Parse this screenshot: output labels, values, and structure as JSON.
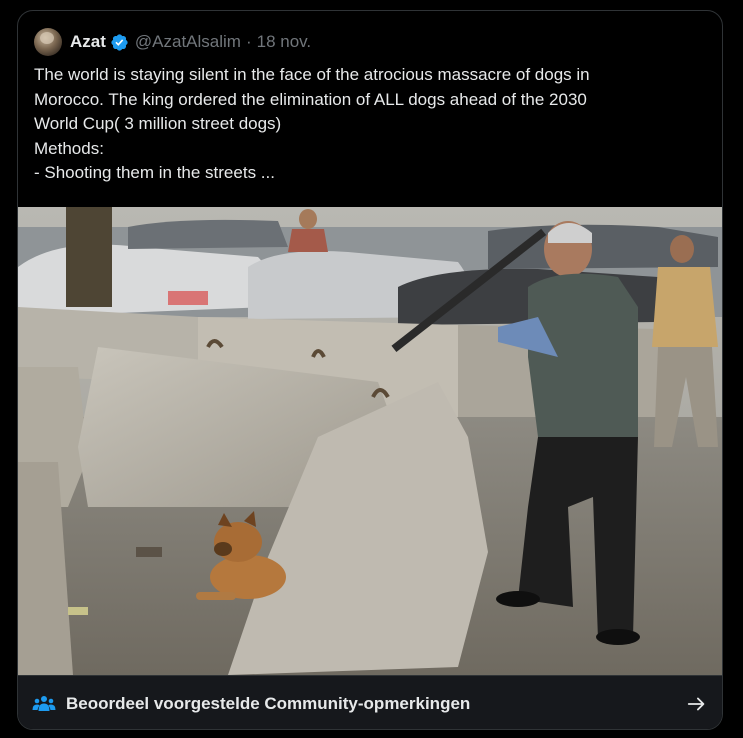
{
  "tweet": {
    "display_name": "Azat",
    "handle": "@AzatAlsalim",
    "separator": "·",
    "date": "18 nov.",
    "text": "The world is staying silent in the face of the atrocious massacre of dogs in\nMorocco. The king ordered the elimination of ALL dogs ahead of the 2030\nWorld Cup( 3 million street dogs)\nMethods:\n- Shooting them in the streets  ..."
  },
  "community_notes": {
    "label": "Beoordeel voorgestelde Community-opmerkingen"
  },
  "icons": {
    "verified": "verified-badge-icon",
    "people": "people-icon",
    "arrow": "arrow-right-icon"
  },
  "colors": {
    "background": "#000000",
    "text_primary": "#e7e9ea",
    "text_secondary": "#71767b",
    "verified_blue": "#1d9bf0",
    "bar_background": "#16181c",
    "border": "#2f3336"
  }
}
